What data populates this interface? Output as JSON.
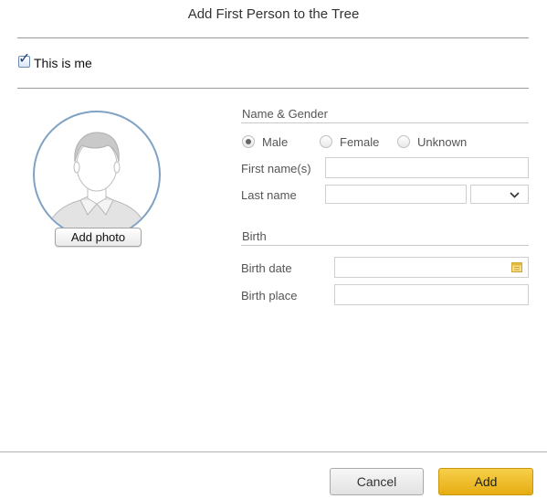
{
  "dialog": {
    "title": "Add First Person to the Tree"
  },
  "this_is_me": {
    "label": "This is me",
    "checked": true
  },
  "photo": {
    "button_label": "Add photo"
  },
  "name_gender": {
    "section_title": "Name & Gender",
    "gender_options": [
      "Male",
      "Female",
      "Unknown"
    ],
    "selected_gender": "Male",
    "first_name_label": "First name(s)",
    "first_name_value": "",
    "last_name_label": "Last name",
    "last_name_value": "",
    "suffix_value": ""
  },
  "birth": {
    "section_title": "Birth",
    "date_label": "Birth date",
    "date_value": "",
    "place_label": "Birth place",
    "place_value": ""
  },
  "footer": {
    "cancel_label": "Cancel",
    "add_label": "Add"
  },
  "colors": {
    "accent": "#e6ad12",
    "avatar_border": "#7fa2c3"
  }
}
